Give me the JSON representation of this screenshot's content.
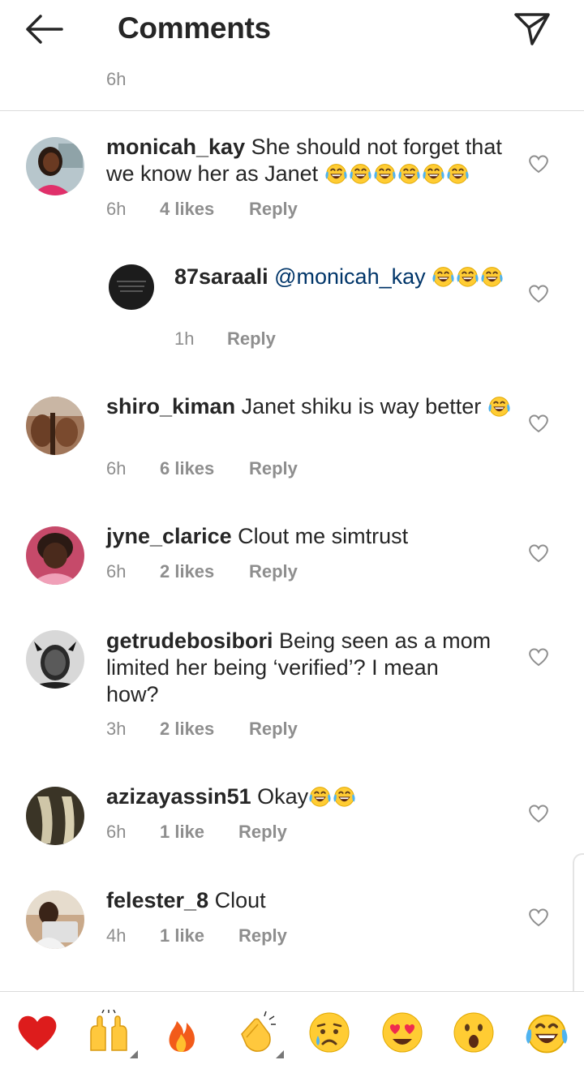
{
  "header": {
    "title": "Comments"
  },
  "previous_time": "6h",
  "comments": [
    {
      "username": "monicah_kay",
      "text": "She should not forget that we know her as Janet",
      "time": "6h",
      "likes": "4 likes",
      "reply": "Reply",
      "emoji_count": 6
    },
    {
      "username": "87saraali",
      "mention": "@monicah_kay",
      "time": "1h",
      "reply": "Reply",
      "emoji_count": 3
    },
    {
      "username": "shiro_kiman",
      "text": "Janet shiku is way better",
      "time": "6h",
      "likes": "6 likes",
      "reply": "Reply",
      "emoji_count": 1
    },
    {
      "username": "jyne_clarice",
      "text": "Clout me simtrust",
      "time": "6h",
      "likes": "2 likes",
      "reply": "Reply"
    },
    {
      "username": "getrudebosibori",
      "text_line1": "Being seen as a mom",
      "text_line2": "limited her being ‘verified’? I mean",
      "text_line3": "how?",
      "time": "3h",
      "likes": "2 likes",
      "reply": "Reply"
    },
    {
      "username": "azizayassin51",
      "text": "Okay",
      "time": "6h",
      "likes": "1 like",
      "reply": "Reply",
      "emoji_count": 2
    },
    {
      "username": "felester_8",
      "text": "Clout",
      "time": "4h",
      "likes": "1 like",
      "reply": "Reply"
    }
  ],
  "reactions": [
    "heart-emoji",
    "raised-hands-emoji",
    "fire-emoji",
    "clapping-hands-emoji",
    "crying-face-emoji",
    "heart-eyes-emoji",
    "surprised-face-emoji",
    "tears-of-joy-emoji"
  ],
  "colors": {
    "text": "#262626",
    "muted": "#8e8e8e",
    "mention": "#003569",
    "divider": "#dbdbdb"
  }
}
